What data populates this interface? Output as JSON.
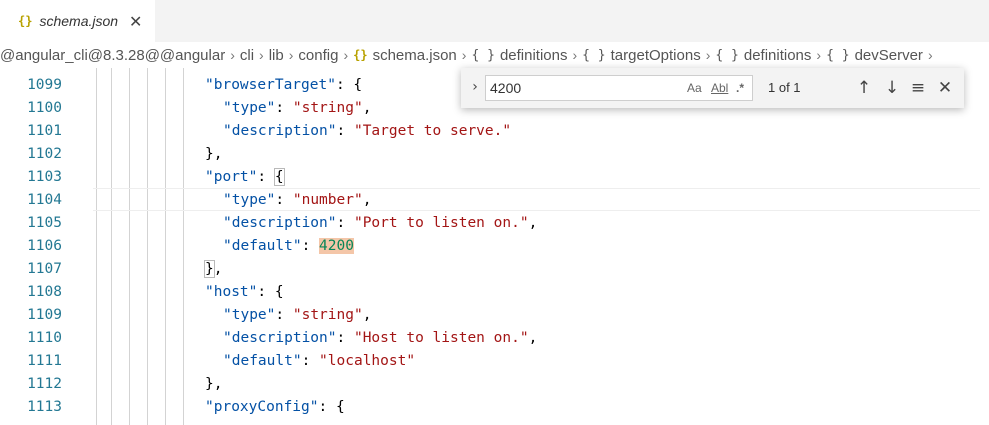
{
  "tab": {
    "title": "schema.json",
    "icon": "json-braces-icon",
    "close": "✕"
  },
  "breadcrumb": {
    "items": [
      {
        "label": "@angular_cli@8.3.28@@angular"
      },
      {
        "label": "cli"
      },
      {
        "label": "lib"
      },
      {
        "label": "config"
      },
      {
        "label": "schema.json",
        "icon": "{}"
      },
      {
        "label": "definitions",
        "icon": "{ }"
      },
      {
        "label": "targetOptions",
        "icon": "{ }"
      },
      {
        "label": "definitions",
        "icon": "{ }"
      },
      {
        "label": "devServer",
        "icon": "{ }"
      }
    ]
  },
  "find": {
    "value": "4200",
    "match_case": "Aa",
    "whole_word": "Abl",
    "regex": ".*",
    "count": "1 of 1"
  },
  "editor": {
    "lines": [
      {
        "n": "1099",
        "indent": 4,
        "key": "\"browserTarget\"",
        "sep": ": {"
      },
      {
        "n": "1100",
        "indent": 5,
        "key": "\"type\"",
        "sep": ": ",
        "str": "\"string\"",
        "end": ","
      },
      {
        "n": "1101",
        "indent": 5,
        "key": "\"description\"",
        "sep": ": ",
        "str": "\"Target to serve.\""
      },
      {
        "n": "1102",
        "indent": 4,
        "plain": "},"
      },
      {
        "n": "1103",
        "indent": 4,
        "key": "\"port\"",
        "sep": ": ",
        "bracket": "{"
      },
      {
        "n": "1104",
        "indent": 5,
        "key": "\"type\"",
        "sep": ": ",
        "str": "\"number\"",
        "end": ","
      },
      {
        "n": "1105",
        "indent": 5,
        "key": "\"description\"",
        "sep": ": ",
        "str": "\"Port to listen on.\"",
        "end": ","
      },
      {
        "n": "1106",
        "indent": 5,
        "key": "\"default\"",
        "sep": ": ",
        "match": "4200"
      },
      {
        "n": "1107",
        "indent": 4,
        "bracket": "}",
        "end": ","
      },
      {
        "n": "1108",
        "indent": 4,
        "key": "\"host\"",
        "sep": ": {"
      },
      {
        "n": "1109",
        "indent": 5,
        "key": "\"type\"",
        "sep": ": ",
        "str": "\"string\"",
        "end": ","
      },
      {
        "n": "1110",
        "indent": 5,
        "key": "\"description\"",
        "sep": ": ",
        "str": "\"Host to listen on.\"",
        "end": ","
      },
      {
        "n": "1111",
        "indent": 5,
        "key": "\"default\"",
        "sep": ": ",
        "str": "\"localhost\""
      },
      {
        "n": "1112",
        "indent": 4,
        "plain": "},"
      },
      {
        "n": "1113",
        "indent": 4,
        "key": "\"proxyConfig\"",
        "sep": ": {"
      }
    ]
  }
}
